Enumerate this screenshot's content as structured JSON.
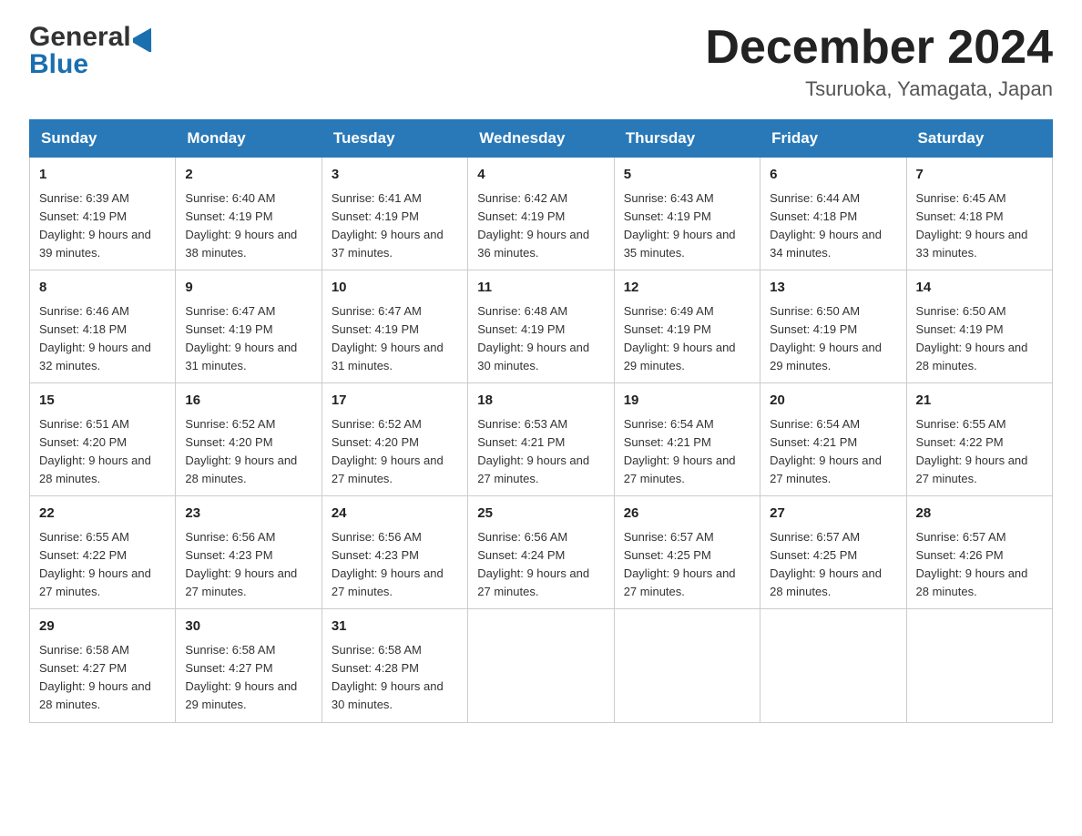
{
  "header": {
    "logo_general": "General",
    "logo_blue": "Blue",
    "month_title": "December 2024",
    "location": "Tsuruoka, Yamagata, Japan"
  },
  "weekdays": [
    "Sunday",
    "Monday",
    "Tuesday",
    "Wednesday",
    "Thursday",
    "Friday",
    "Saturday"
  ],
  "weeks": [
    [
      {
        "day": "1",
        "sunrise": "Sunrise: 6:39 AM",
        "sunset": "Sunset: 4:19 PM",
        "daylight": "Daylight: 9 hours and 39 minutes."
      },
      {
        "day": "2",
        "sunrise": "Sunrise: 6:40 AM",
        "sunset": "Sunset: 4:19 PM",
        "daylight": "Daylight: 9 hours and 38 minutes."
      },
      {
        "day": "3",
        "sunrise": "Sunrise: 6:41 AM",
        "sunset": "Sunset: 4:19 PM",
        "daylight": "Daylight: 9 hours and 37 minutes."
      },
      {
        "day": "4",
        "sunrise": "Sunrise: 6:42 AM",
        "sunset": "Sunset: 4:19 PM",
        "daylight": "Daylight: 9 hours and 36 minutes."
      },
      {
        "day": "5",
        "sunrise": "Sunrise: 6:43 AM",
        "sunset": "Sunset: 4:19 PM",
        "daylight": "Daylight: 9 hours and 35 minutes."
      },
      {
        "day": "6",
        "sunrise": "Sunrise: 6:44 AM",
        "sunset": "Sunset: 4:18 PM",
        "daylight": "Daylight: 9 hours and 34 minutes."
      },
      {
        "day": "7",
        "sunrise": "Sunrise: 6:45 AM",
        "sunset": "Sunset: 4:18 PM",
        "daylight": "Daylight: 9 hours and 33 minutes."
      }
    ],
    [
      {
        "day": "8",
        "sunrise": "Sunrise: 6:46 AM",
        "sunset": "Sunset: 4:18 PM",
        "daylight": "Daylight: 9 hours and 32 minutes."
      },
      {
        "day": "9",
        "sunrise": "Sunrise: 6:47 AM",
        "sunset": "Sunset: 4:19 PM",
        "daylight": "Daylight: 9 hours and 31 minutes."
      },
      {
        "day": "10",
        "sunrise": "Sunrise: 6:47 AM",
        "sunset": "Sunset: 4:19 PM",
        "daylight": "Daylight: 9 hours and 31 minutes."
      },
      {
        "day": "11",
        "sunrise": "Sunrise: 6:48 AM",
        "sunset": "Sunset: 4:19 PM",
        "daylight": "Daylight: 9 hours and 30 minutes."
      },
      {
        "day": "12",
        "sunrise": "Sunrise: 6:49 AM",
        "sunset": "Sunset: 4:19 PM",
        "daylight": "Daylight: 9 hours and 29 minutes."
      },
      {
        "day": "13",
        "sunrise": "Sunrise: 6:50 AM",
        "sunset": "Sunset: 4:19 PM",
        "daylight": "Daylight: 9 hours and 29 minutes."
      },
      {
        "day": "14",
        "sunrise": "Sunrise: 6:50 AM",
        "sunset": "Sunset: 4:19 PM",
        "daylight": "Daylight: 9 hours and 28 minutes."
      }
    ],
    [
      {
        "day": "15",
        "sunrise": "Sunrise: 6:51 AM",
        "sunset": "Sunset: 4:20 PM",
        "daylight": "Daylight: 9 hours and 28 minutes."
      },
      {
        "day": "16",
        "sunrise": "Sunrise: 6:52 AM",
        "sunset": "Sunset: 4:20 PM",
        "daylight": "Daylight: 9 hours and 28 minutes."
      },
      {
        "day": "17",
        "sunrise": "Sunrise: 6:52 AM",
        "sunset": "Sunset: 4:20 PM",
        "daylight": "Daylight: 9 hours and 27 minutes."
      },
      {
        "day": "18",
        "sunrise": "Sunrise: 6:53 AM",
        "sunset": "Sunset: 4:21 PM",
        "daylight": "Daylight: 9 hours and 27 minutes."
      },
      {
        "day": "19",
        "sunrise": "Sunrise: 6:54 AM",
        "sunset": "Sunset: 4:21 PM",
        "daylight": "Daylight: 9 hours and 27 minutes."
      },
      {
        "day": "20",
        "sunrise": "Sunrise: 6:54 AM",
        "sunset": "Sunset: 4:21 PM",
        "daylight": "Daylight: 9 hours and 27 minutes."
      },
      {
        "day": "21",
        "sunrise": "Sunrise: 6:55 AM",
        "sunset": "Sunset: 4:22 PM",
        "daylight": "Daylight: 9 hours and 27 minutes."
      }
    ],
    [
      {
        "day": "22",
        "sunrise": "Sunrise: 6:55 AM",
        "sunset": "Sunset: 4:22 PM",
        "daylight": "Daylight: 9 hours and 27 minutes."
      },
      {
        "day": "23",
        "sunrise": "Sunrise: 6:56 AM",
        "sunset": "Sunset: 4:23 PM",
        "daylight": "Daylight: 9 hours and 27 minutes."
      },
      {
        "day": "24",
        "sunrise": "Sunrise: 6:56 AM",
        "sunset": "Sunset: 4:23 PM",
        "daylight": "Daylight: 9 hours and 27 minutes."
      },
      {
        "day": "25",
        "sunrise": "Sunrise: 6:56 AM",
        "sunset": "Sunset: 4:24 PM",
        "daylight": "Daylight: 9 hours and 27 minutes."
      },
      {
        "day": "26",
        "sunrise": "Sunrise: 6:57 AM",
        "sunset": "Sunset: 4:25 PM",
        "daylight": "Daylight: 9 hours and 27 minutes."
      },
      {
        "day": "27",
        "sunrise": "Sunrise: 6:57 AM",
        "sunset": "Sunset: 4:25 PM",
        "daylight": "Daylight: 9 hours and 28 minutes."
      },
      {
        "day": "28",
        "sunrise": "Sunrise: 6:57 AM",
        "sunset": "Sunset: 4:26 PM",
        "daylight": "Daylight: 9 hours and 28 minutes."
      }
    ],
    [
      {
        "day": "29",
        "sunrise": "Sunrise: 6:58 AM",
        "sunset": "Sunset: 4:27 PM",
        "daylight": "Daylight: 9 hours and 28 minutes."
      },
      {
        "day": "30",
        "sunrise": "Sunrise: 6:58 AM",
        "sunset": "Sunset: 4:27 PM",
        "daylight": "Daylight: 9 hours and 29 minutes."
      },
      {
        "day": "31",
        "sunrise": "Sunrise: 6:58 AM",
        "sunset": "Sunset: 4:28 PM",
        "daylight": "Daylight: 9 hours and 30 minutes."
      },
      null,
      null,
      null,
      null
    ]
  ]
}
